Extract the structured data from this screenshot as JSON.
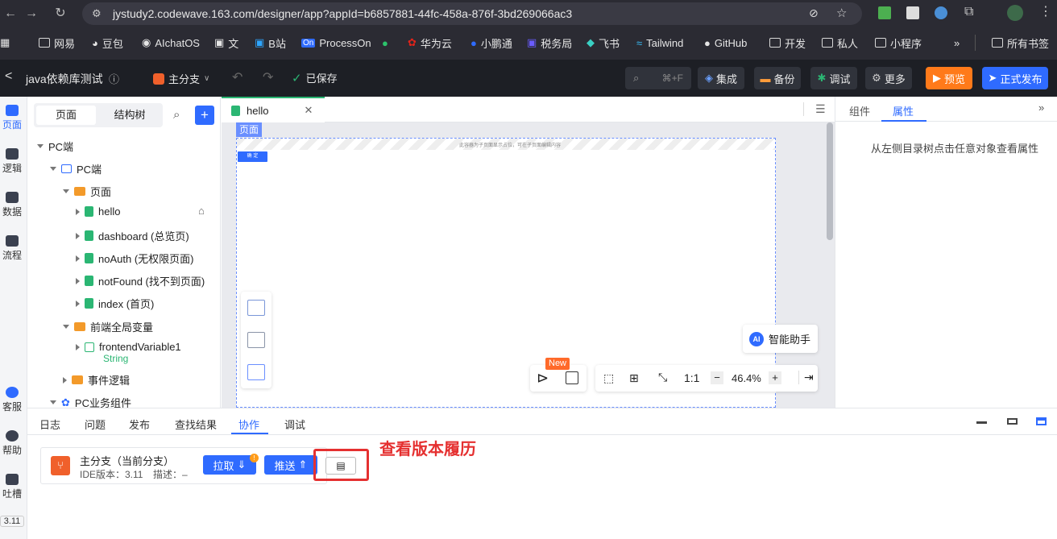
{
  "browser": {
    "url": "jystudy2.codewave.163.com/designer/app?appId=b6857881-44fc-458a-876f-3bd269066ac3",
    "bookmarks": [
      "网易",
      "豆包",
      "AIchatOS",
      "文",
      "B站",
      "ProcessOn",
      "",
      "华为云",
      "小鹏通",
      "税务局",
      "飞书",
      "Tailwind",
      "GitHub",
      "开发",
      "私人",
      "小程序"
    ],
    "more_bookmarks": "»",
    "all_bookmarks": "所有书签"
  },
  "header": {
    "back": "<",
    "app_name": "java依赖库测试",
    "branch": "主分支",
    "saved": "已保存",
    "search_shortcut": "⌘+F",
    "buttons": {
      "integrate": "集成",
      "backup": "备份",
      "debug": "调试",
      "more": "更多",
      "preview": "预览",
      "publish": "正式发布"
    }
  },
  "rail": [
    {
      "label": "页面"
    },
    {
      "label": "逻辑"
    },
    {
      "label": "数据"
    },
    {
      "label": "流程"
    },
    {
      "label": "客服"
    },
    {
      "label": "帮助"
    },
    {
      "label": "吐槽"
    }
  ],
  "rail_version": "3.11",
  "tree": {
    "tabs": [
      "页面",
      "结构树"
    ],
    "nodes": {
      "pc_root": "PC端",
      "pc": "PC端",
      "pages": "页面",
      "hello": "hello",
      "dashboard": "dashboard (总览页)",
      "noauth": "noAuth (无权限页面)",
      "notfound": "notFound (找不到页面)",
      "index": "index (首页)",
      "global_vars": "前端全局变量",
      "var1": "frontendVariable1",
      "var1_type": "String",
      "events": "事件逻辑",
      "components": "PC业务组件"
    }
  },
  "editor": {
    "tab": "hello",
    "canvas_label": "页面",
    "hint": "此容器为子页面显示占位，可在子页面编辑内容",
    "confirm_btn": "确 定",
    "new_badge": "New",
    "zoom": "46.4%",
    "ratio": "1:1",
    "ai_label": "AI",
    "ai_assistant": "智能助手"
  },
  "right": {
    "tabs": [
      "组件",
      "属性"
    ],
    "empty_text": "从左侧目录树点击任意对象查看属性"
  },
  "bottom": {
    "tabs": [
      "日志",
      "问题",
      "发布",
      "查找结果",
      "协作",
      "调试"
    ],
    "branch_title": "主分支（当前分支）",
    "ide_version": "IDE版本：3.11",
    "desc": "描述：–",
    "pull": "拉取",
    "push": "推送",
    "annotation": "查看版本履历"
  },
  "colors": {
    "accent": "#2f6bff",
    "preview": "#ff7a1a",
    "annotation_red": "#e53030"
  }
}
